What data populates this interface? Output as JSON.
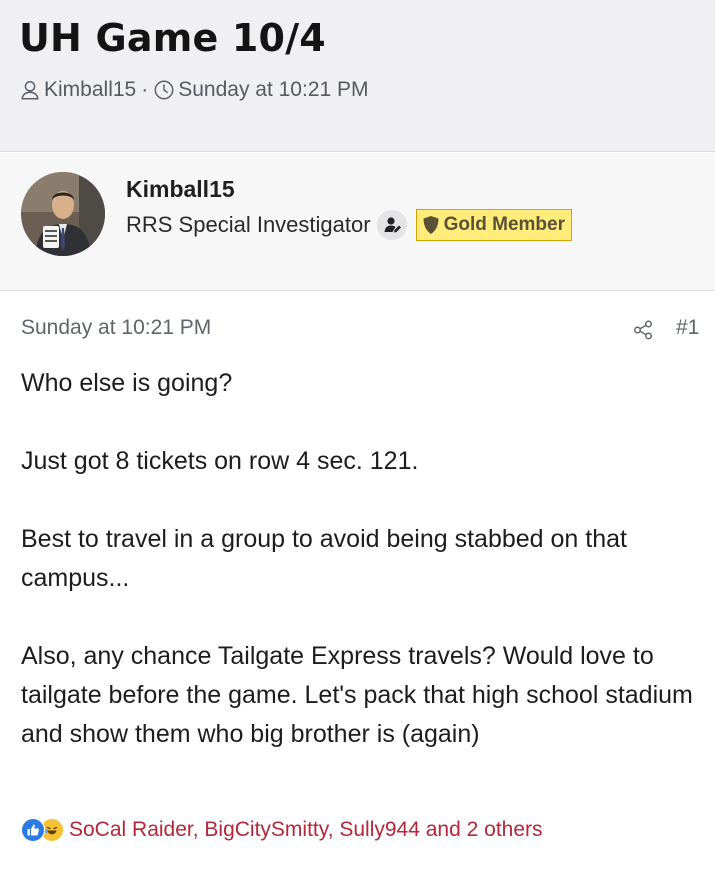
{
  "thread": {
    "title": "UH Game 10/4",
    "starter": "Kimball15",
    "separator": "·",
    "started_at": "Sunday at 10:21 PM"
  },
  "author": {
    "username": "Kimball15",
    "user_title": "RRS Special Investigator",
    "badge_label": "Gold Member",
    "badge_color": "#ffec7a",
    "icons": [
      "user-icon",
      "clock-icon",
      "moderator-icon",
      "shield-icon"
    ]
  },
  "post": {
    "date": "Sunday at 10:21 PM",
    "number": "#1",
    "paragraphs": [
      "Who else is going?",
      "Just got 8 tickets on row 4 sec. 121.",
      "Best to travel in a group to avoid being stabbed on that campus...",
      "Also, any chance Tailgate Express travels? Would love to tailgate before the game. Let's pack that high school stadium and show them who big brother is (again)"
    ],
    "share_icon": "share-icon"
  },
  "reactions": {
    "text": "SoCal Raider, BigCitySmitty, Sully944 and 2 others",
    "icons": [
      "like-icon",
      "laugh-icon"
    ],
    "text_color": "#b5263a"
  }
}
